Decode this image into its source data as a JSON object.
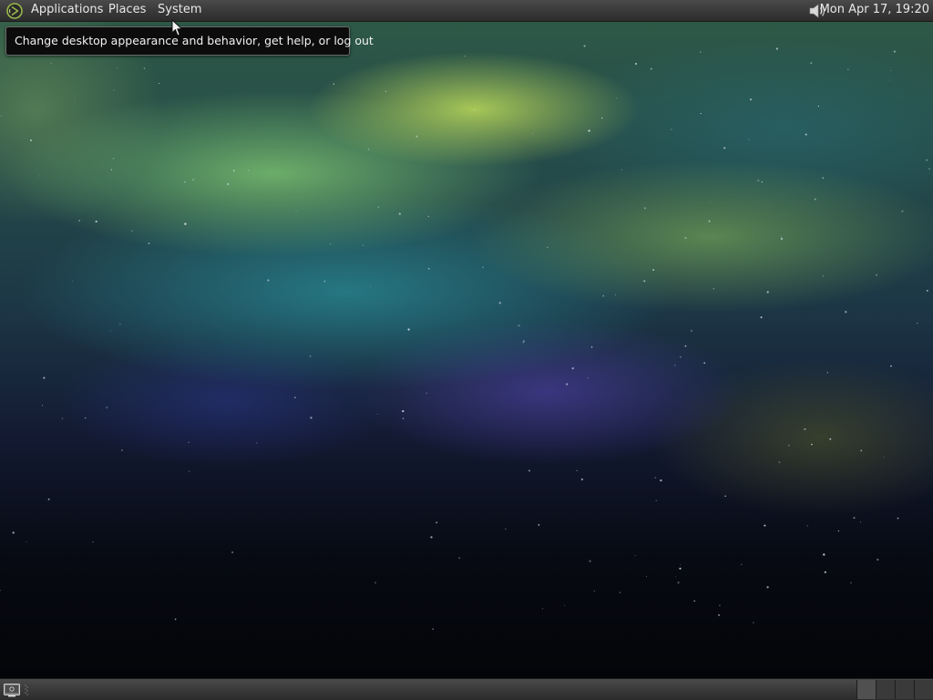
{
  "top_panel": {
    "menus": {
      "applications": "Applications",
      "places": "Places",
      "system": "System"
    },
    "logo_icon": "distro-logo-icon",
    "volume_icon": "speaker-icon",
    "clock": "Mon Apr 17, 19:20"
  },
  "tooltip": {
    "text": "Change desktop appearance and behavior, get help, or log out"
  },
  "bottom_panel": {
    "show_desktop_icon": "show-desktop-icon",
    "workspace_count": 4,
    "active_workspace": 1
  },
  "colors": {
    "panel": "#3a3a3a",
    "panel_text": "#e8e8e8",
    "tooltip_bg": "#0c0c0c",
    "logo_accent": "#9ab84a"
  }
}
